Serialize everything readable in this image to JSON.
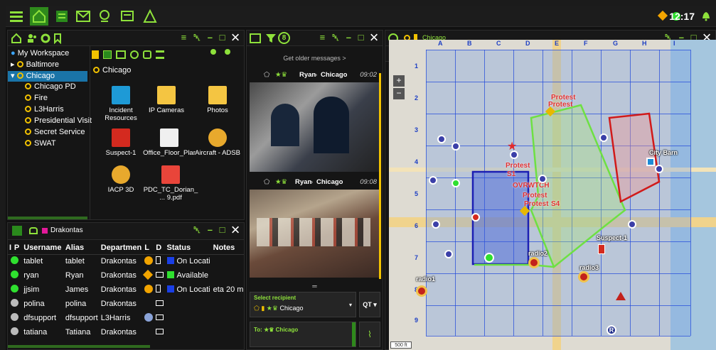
{
  "topbar": {
    "clock": "12:17"
  },
  "workspace": {
    "items": [
      {
        "label": "My Workspace"
      },
      {
        "label": "Baltimore"
      },
      {
        "label": "Chicago"
      },
      {
        "label": "Chicago PD"
      },
      {
        "label": "Fire"
      },
      {
        "label": "L3Harris"
      },
      {
        "label": "Presidential Visit"
      },
      {
        "label": "Secret Service"
      },
      {
        "label": "SWAT"
      }
    ],
    "folder_title": "Chicago",
    "files": [
      {
        "label": "Incident Resources"
      },
      {
        "label": "IP Cameras"
      },
      {
        "label": "Photos"
      },
      {
        "label": "Suspect-1"
      },
      {
        "label": "Office_Floor_Plar"
      },
      {
        "label": "Aircraft - ADSB"
      },
      {
        "label": "IACP 3D"
      },
      {
        "label": "PDC_TC_Dorian_ ... 9.pdf"
      }
    ]
  },
  "users_panel": {
    "title": "Drakontas",
    "columns": [
      "I",
      "P",
      "Username",
      "Alias",
      "Departmen",
      "L",
      "D",
      "Status",
      "Notes"
    ],
    "rows": [
      {
        "username": "tablet",
        "alias": "tablet",
        "dept": "Drakontas",
        "status": "On Locati",
        "notes": ""
      },
      {
        "username": "ryan",
        "alias": "Ryan",
        "dept": "Drakontas",
        "status": "Available",
        "notes": ""
      },
      {
        "username": "jjsim",
        "alias": "James",
        "dept": "Drakontas",
        "status": "On Locati",
        "notes": "eta 20 min"
      },
      {
        "username": "polina",
        "alias": "polina",
        "dept": "Drakontas",
        "status": "",
        "notes": ""
      },
      {
        "username": "dfsupport",
        "alias": "dfsupport",
        "dept": "L3Harris",
        "status": "",
        "notes": ""
      },
      {
        "username": "tatiana",
        "alias": "Tatiana",
        "dept": "Drakontas",
        "status": "",
        "notes": ""
      }
    ]
  },
  "messages": {
    "filter_count": "8",
    "older_link": "Get older messages >",
    "items": [
      {
        "from": "Ryan",
        "to": "Chicago",
        "time": "09:02"
      },
      {
        "from": "Ryan",
        "to": "Chicago",
        "time": "09:08"
      }
    ],
    "recipient_label": "Select recipient",
    "recipient_value": "Chicago",
    "to_label": "To:",
    "to_value": "Chicago",
    "qt_label": "QT"
  },
  "map": {
    "title": "Chicago",
    "columns": [
      "A",
      "B",
      "C",
      "D",
      "E",
      "F",
      "G",
      "H",
      "I"
    ],
    "rows": [
      "1",
      "2",
      "3",
      "4",
      "5",
      "6",
      "7",
      "8",
      "9"
    ],
    "labels": {
      "protest1": "Protest",
      "protest2": "Protest",
      "protest3": "Protest",
      "protest4": "Protest",
      "protest5": "Protest",
      "protest6": "Protest",
      "ovrwtch": "OVRWTCH",
      "city_barn": "City Barn",
      "suspect": "Suspect-1",
      "radio1": "radio1",
      "radio2": "radio2",
      "radio3": "radio3",
      "protest1b": "S1",
      "protest4b": "S4"
    },
    "scale": "500 ft",
    "zoom_in": "+",
    "zoom_out": "−"
  }
}
